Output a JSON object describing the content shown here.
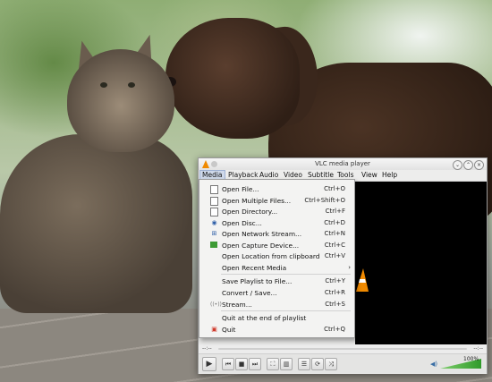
{
  "window": {
    "title": "VLC media player"
  },
  "menubar": [
    "Media",
    "Playback",
    "Audio",
    "Video",
    "Subtitle",
    "Tools",
    "View",
    "Help"
  ],
  "media_menu": [
    {
      "label": "Open File...",
      "shortcut": "Ctrl+O",
      "icon": "open-file-icon"
    },
    {
      "label": "Open Multiple Files...",
      "shortcut": "Ctrl+Shift+O",
      "icon": "open-multiple-files-icon"
    },
    {
      "label": "Open Directory...",
      "shortcut": "Ctrl+F",
      "icon": "folder-icon"
    },
    {
      "label": "Open Disc...",
      "shortcut": "Ctrl+D",
      "icon": "disc-icon"
    },
    {
      "label": "Open Network Stream...",
      "shortcut": "Ctrl+N",
      "icon": "network-icon"
    },
    {
      "label": "Open Capture Device...",
      "shortcut": "Ctrl+C",
      "icon": "capture-device-icon"
    },
    {
      "label": "Open Location from clipboard",
      "shortcut": "Ctrl+V",
      "icon": ""
    },
    {
      "label": "Open Recent Media",
      "shortcut": "",
      "icon": "",
      "submenu": true
    },
    {
      "label": "Save Playlist to File...",
      "shortcut": "Ctrl+Y",
      "icon": ""
    },
    {
      "label": "Convert / Save...",
      "shortcut": "Ctrl+R",
      "icon": ""
    },
    {
      "label": "Stream...",
      "shortcut": "Ctrl+S",
      "icon": "stream-icon"
    },
    {
      "label": "Quit at the end of playlist",
      "shortcut": "",
      "icon": ""
    },
    {
      "label": "Quit",
      "shortcut": "Ctrl+Q",
      "icon": "quit-icon"
    }
  ],
  "seek": {
    "elapsed": "--:--",
    "remaining": "--:--"
  },
  "volume": {
    "percent_text": "100%",
    "level": 1.0
  },
  "colors": {
    "vlc_orange": "#f08a00",
    "menu_highlight": "#cfd9ea",
    "volume_green": "#2f9a2a"
  }
}
